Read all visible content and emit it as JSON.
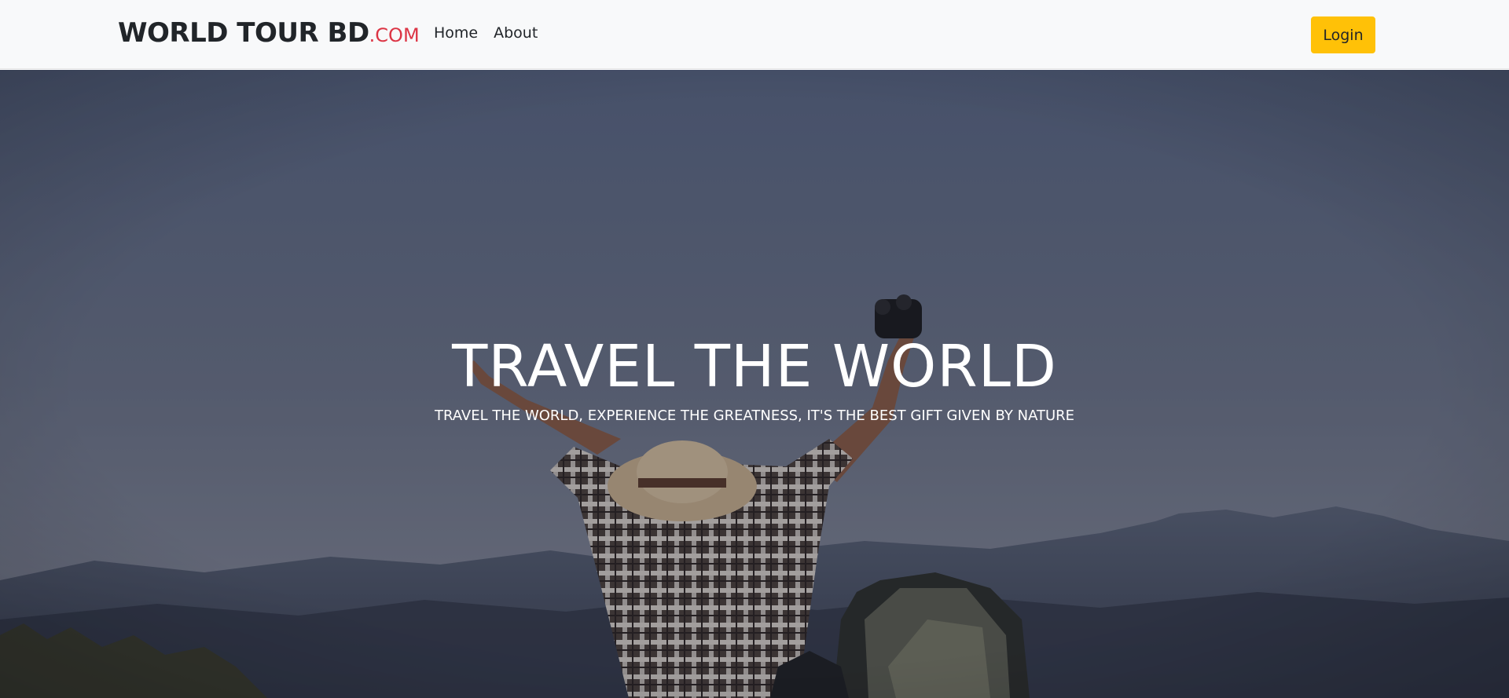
{
  "navbar": {
    "brand_main": "WORLD TOUR BD",
    "brand_suffix": ".COM",
    "links": [
      {
        "label": "Home"
      },
      {
        "label": "About"
      }
    ],
    "login_label": "Login"
  },
  "hero": {
    "title": "TRAVEL THE WORLD",
    "subtitle": "TRAVEL THE WORLD, EXPERIENCE THE GREATNESS, IT'S THE BEST GIFT GIVEN BY NATURE",
    "image_subject": "traveler-with-raised-arms-and-backpack-on-mountain"
  },
  "colors": {
    "navbar_bg": "#f8f9fa",
    "brand_text": "#212529",
    "brand_accent": "#dc3545",
    "login_button": "#ffc107",
    "hero_text": "#ffffff"
  }
}
